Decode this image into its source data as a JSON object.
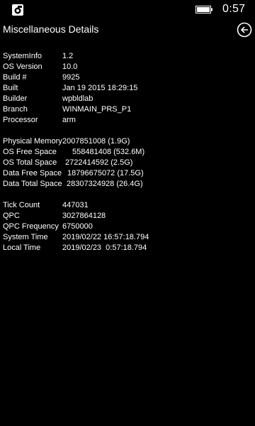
{
  "status_bar": {
    "time": "0:57",
    "icons": [
      "app-icon",
      "battery-icon"
    ]
  },
  "header": {
    "title": "Miscellaneous Details",
    "back_icon": "back-arrow-circle-icon"
  },
  "groups": [
    {
      "rows": [
        {
          "label": "SystemInfo",
          "value": "1.2",
          "indent": 84
        },
        {
          "label": "OS Version",
          "value": "10.0",
          "indent": 84
        },
        {
          "label": "Build #",
          "value": "9925",
          "indent": 84
        },
        {
          "label": "Built",
          "value": "Jan 19 2015 18:29:15",
          "indent": 84
        },
        {
          "label": "Builder",
          "value": "wpbldlab",
          "indent": 84
        },
        {
          "label": "Branch",
          "value": "WINMAIN_PRS_P1",
          "indent": 84
        },
        {
          "label": "Processor",
          "value": "arm",
          "indent": 84
        }
      ]
    },
    {
      "rows": [
        {
          "label": "Physical Memory",
          "value": "2007851008 (1.9G)",
          "indent": 84
        },
        {
          "label": "OS Free Space",
          "value": "558481408 (532.6M)",
          "indent": 84
        },
        {
          "label": "OS Total Space",
          "value": "2722414592 (2.5G)",
          "indent": 84
        },
        {
          "label": "Data Free Space",
          "value": "18796675072 (17.5G)",
          "indent": 84
        },
        {
          "label": "Data Total Space",
          "value": "28307324928 (26.4G)",
          "indent": 84
        }
      ]
    },
    {
      "rows": [
        {
          "label": "Tick Count",
          "value": "447031",
          "indent": 84
        },
        {
          "label": "QPC",
          "value": "3027864128",
          "indent": 84
        },
        {
          "label": "QPC Frequency",
          "value": "6750000",
          "indent": 84
        },
        {
          "label": "System Time",
          "value": "2019/02/22 16:57:18.794",
          "indent": 84
        },
        {
          "label": "Local Time",
          "value": "2019/02/23  0:57:18.794",
          "indent": 84
        }
      ]
    }
  ]
}
